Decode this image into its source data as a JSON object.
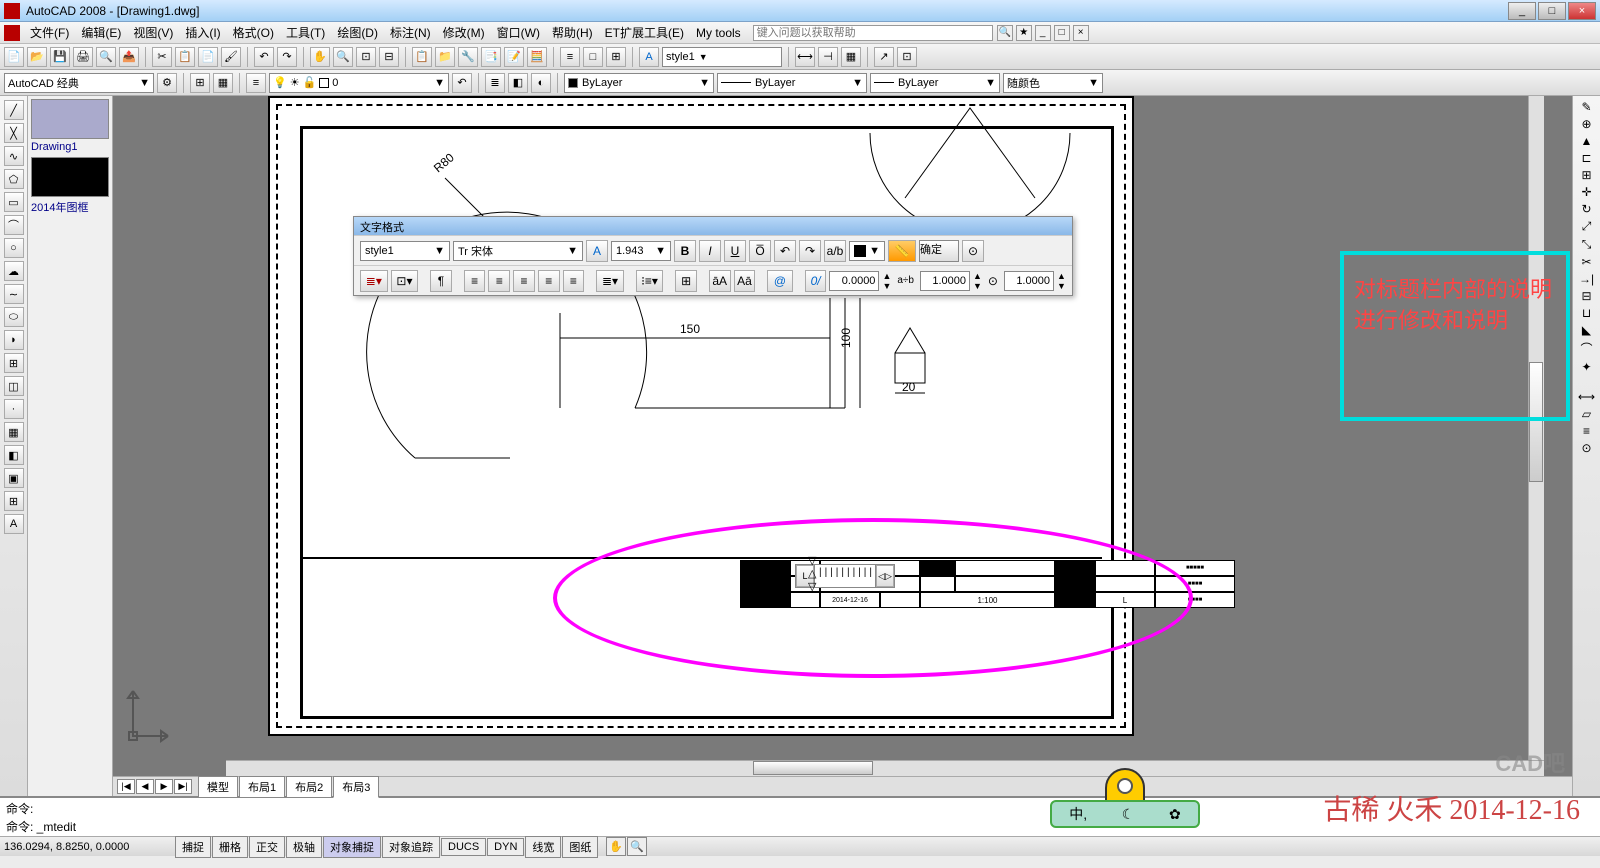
{
  "titlebar": {
    "app": "AutoCAD 2008 - [Drawing1.dwg]"
  },
  "window_controls": {
    "min": "_",
    "max": "□",
    "close": "×"
  },
  "menu": {
    "items": [
      "文件(F)",
      "编辑(E)",
      "视图(V)",
      "插入(I)",
      "格式(O)",
      "工具(T)",
      "绘图(D)",
      "标注(N)",
      "修改(M)",
      "窗口(W)",
      "帮助(H)",
      "ET扩展工具(E)",
      "My tools"
    ],
    "help_placeholder": "键入问题以获取帮助"
  },
  "toolbar1": {
    "style_dropdown": "style1"
  },
  "workspace": {
    "ws_name": "AutoCAD 经典",
    "layer_value": "0"
  },
  "props": {
    "bylayer_color": "ByLayer",
    "bylayer_line": "ByLayer",
    "bylayer_lw": "ByLayer",
    "plot_color": "随颜色"
  },
  "files": {
    "f1": "Drawing1",
    "f2": "2014年图框"
  },
  "text_editor": {
    "title": "文字格式",
    "style": "style1",
    "font": "宋体",
    "height": "1.943",
    "bold": "B",
    "italic": "I",
    "underline": "U",
    "overline": "O̅",
    "ok": "确定",
    "tracking": "0.0000",
    "width_factor": "1.0000",
    "oblique": "1.0000",
    "ab_label": "a÷b",
    "at_symbol": "@",
    "oblique_symbol": "0/"
  },
  "dimensions": {
    "r80": "R80",
    "d150": "150",
    "d100": "100",
    "d20": "20"
  },
  "titleblock": {
    "date": "2014-12-16",
    "scale": "1:100"
  },
  "annotation": {
    "note": "对标题栏内部的说明进行修改和说明"
  },
  "tabs": {
    "t1": "模型",
    "t2": "布局1",
    "t3": "布局2",
    "t4": "布局3"
  },
  "command": {
    "prev": "命令:",
    "curr_label": "命令:",
    "curr_cmd": " _mtedit"
  },
  "status": {
    "coords": "136.0294, 8.8250, 0.0000",
    "b1": "捕捉",
    "b2": "栅格",
    "b3": "正交",
    "b4": "极轴",
    "b5": "对象捕捉",
    "b6": "对象追踪",
    "b7": "DUCS",
    "b8": "DYN",
    "b9": "线宽",
    "b10": "图纸"
  },
  "watermark": {
    "text": "古稀 火禾  2014-12-16",
    "cad_badge": "CAD吧"
  },
  "minion_bar": {
    "c1": "中,",
    "c2": "☾",
    "c3": "✿"
  }
}
